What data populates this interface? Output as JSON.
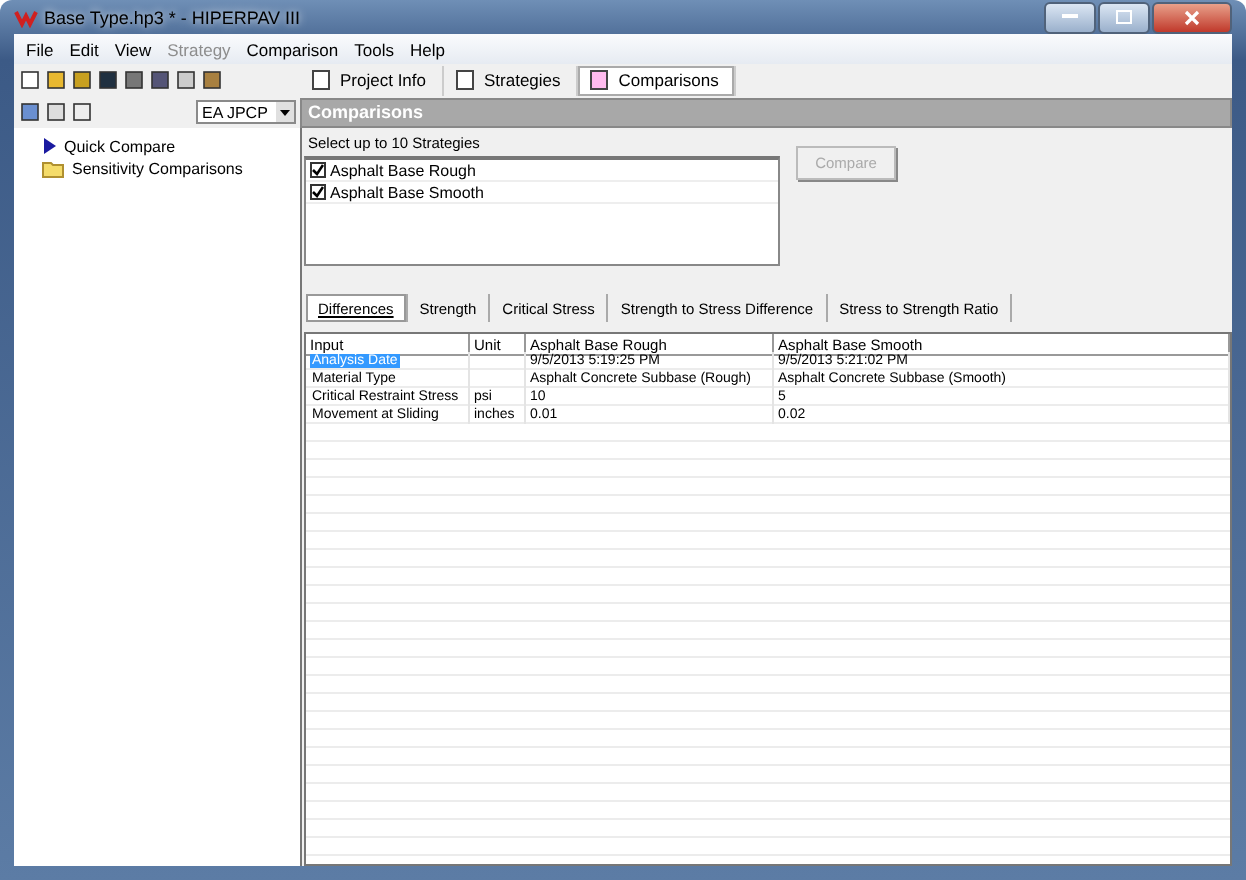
{
  "window": {
    "title": "Base Type.hp3 * - HIPERPAV III"
  },
  "menu": [
    {
      "label": "File",
      "disabled": false
    },
    {
      "label": "Edit",
      "disabled": false
    },
    {
      "label": "View",
      "disabled": false
    },
    {
      "label": "Strategy",
      "disabled": true
    },
    {
      "label": "Comparison",
      "disabled": false
    },
    {
      "label": "Tools",
      "disabled": false
    },
    {
      "label": "Help",
      "disabled": false
    }
  ],
  "view_tabs": [
    {
      "label": "Project Info",
      "selected": false
    },
    {
      "label": "Strategies",
      "selected": false
    },
    {
      "label": "Comparisons",
      "selected": true
    }
  ],
  "strategy_dropdown": {
    "value": "EA JPCP"
  },
  "tree": [
    {
      "label": "Quick Compare",
      "kind": "compare"
    },
    {
      "label": "Sensitivity Comparisons",
      "kind": "folder"
    }
  ],
  "panel": {
    "title": "Comparisons",
    "instruction": "Select up to 10 Strategies",
    "strategies": [
      {
        "label": "Asphalt Base Rough",
        "checked": true
      },
      {
        "label": "Asphalt Base Smooth",
        "checked": true
      }
    ],
    "compare_button": {
      "label": "Compare",
      "disabled": true
    },
    "result_tabs": [
      {
        "label": "Differences",
        "selected": true
      },
      {
        "label": "Strength",
        "selected": false
      },
      {
        "label": "Critical Stress",
        "selected": false
      },
      {
        "label": "Strength to Stress Difference",
        "selected": false
      },
      {
        "label": "Stress to Strength Ratio",
        "selected": false
      }
    ],
    "table": {
      "columns": [
        "Input",
        "Unit",
        "Asphalt Base Rough",
        "Asphalt Base Smooth"
      ],
      "rows": [
        {
          "cells": [
            "Analysis Date",
            "",
            "9/5/2013 5:19:25 PM",
            "9/5/2013 5:21:02 PM"
          ],
          "selected": true
        },
        {
          "cells": [
            "Material Type",
            "",
            "Asphalt Concrete Subbase (Rough)",
            "Asphalt Concrete Subbase (Smooth)"
          ],
          "selected": false
        },
        {
          "cells": [
            "Critical Restraint Stress",
            "psi",
            "10",
            "5"
          ],
          "selected": false
        },
        {
          "cells": [
            "Movement at Sliding",
            "inches",
            "0.01",
            "0.02"
          ],
          "selected": false
        }
      ]
    }
  }
}
